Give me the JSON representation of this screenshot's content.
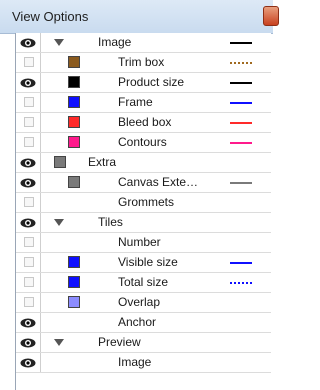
{
  "window": {
    "title": "View Options"
  },
  "colors": {
    "eye": "#111111",
    "trim_box_swatch": "#8a5a1e",
    "product_size_swatch": "#000000",
    "frame_swatch": "#1010ff",
    "bleed_box_swatch": "#ff2a2a",
    "contours_swatch": "#ff1a8c",
    "extra_swatch": "#7a7a7a",
    "canvas_swatch": "#7a7a7a",
    "visible_size_swatch": "#1010ff",
    "total_size_swatch": "#1010ff",
    "overlap_swatch": "#8c8cff"
  },
  "rows": [
    {
      "label": "Image",
      "visible": true,
      "expander": true,
      "line": "solid-black",
      "line_color": "#000000",
      "line_style": "solid"
    },
    {
      "label": "Trim box",
      "visible": false,
      "swatch": "#8a5a1e",
      "line_color": "#a06a20",
      "line_style": "dotted"
    },
    {
      "label": "Product size",
      "visible": true,
      "swatch": "#000000",
      "line_color": "#000000",
      "line_style": "solid"
    },
    {
      "label": "Frame",
      "visible": false,
      "swatch": "#1010ff",
      "line_color": "#1010ff",
      "line_style": "solid"
    },
    {
      "label": "Bleed box",
      "visible": false,
      "swatch": "#ff2a2a",
      "line_color": "#ff2a2a",
      "line_style": "solid"
    },
    {
      "label": "Contours",
      "visible": false,
      "swatch": "#ff1a8c",
      "line_color": "#ff1a8c",
      "line_style": "solid"
    },
    {
      "label": "Extra",
      "visible": true,
      "expander": false,
      "swatch": "#7a7a7a"
    },
    {
      "label": "Canvas Exte…",
      "visible": true,
      "swatch": "#7a7a7a",
      "line_color": "#7a7a7a",
      "line_style": "solid"
    },
    {
      "label": "Grommets",
      "visible": false
    },
    {
      "label": "Tiles",
      "visible": true,
      "expander": true
    },
    {
      "label": "Number",
      "visible": false
    },
    {
      "label": "Visible size",
      "visible": false,
      "swatch": "#1010ff",
      "line_color": "#1010ff",
      "line_style": "solid"
    },
    {
      "label": "Total size",
      "visible": false,
      "swatch": "#1010ff",
      "line_color": "#1010ff",
      "line_style": "dotted"
    },
    {
      "label": "Overlap",
      "visible": false,
      "swatch": "#8c8cff"
    },
    {
      "label": "Anchor",
      "visible": true
    },
    {
      "label": "Preview",
      "visible": true,
      "expander": true
    },
    {
      "label": "Image",
      "visible": true
    }
  ]
}
